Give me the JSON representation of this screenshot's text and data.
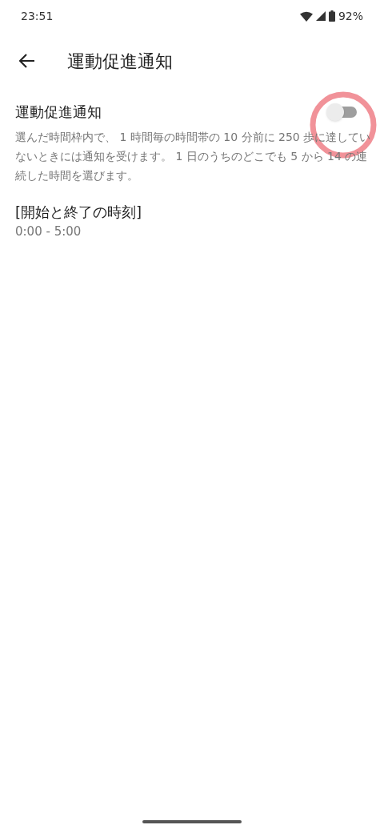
{
  "status_bar": {
    "time": "23:51",
    "battery": "92%"
  },
  "app_bar": {
    "title": "運動促進通知"
  },
  "setting": {
    "title": "運動促進通知",
    "description": "選んだ時間枠内で、 1 時間毎の時間帯の 10 分前に 250 歩に達していないときには通知を受けます。 1 日のうちのどこでも 5 から 14 の連続した時間を選びます。",
    "on": false,
    "highlighted": true
  },
  "time_range": {
    "title": "[開始と終了の時刻]",
    "value": "0:00 - 5:00"
  }
}
